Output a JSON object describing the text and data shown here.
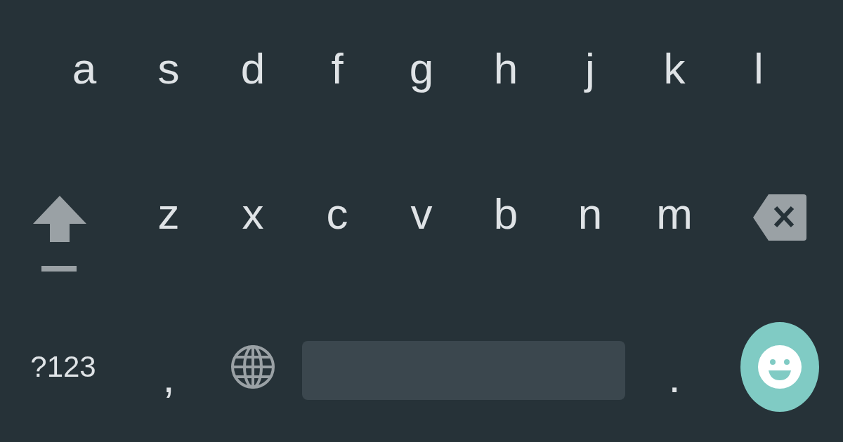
{
  "keyboard": {
    "rows": [
      {
        "keys": [
          {
            "kind": "letter",
            "label": "a"
          },
          {
            "kind": "letter",
            "label": "s"
          },
          {
            "kind": "letter",
            "label": "d"
          },
          {
            "kind": "letter",
            "label": "f"
          },
          {
            "kind": "letter",
            "label": "g"
          },
          {
            "kind": "letter",
            "label": "h"
          },
          {
            "kind": "letter",
            "label": "j"
          },
          {
            "kind": "letter",
            "label": "k"
          },
          {
            "kind": "letter",
            "label": "l"
          }
        ]
      },
      {
        "keys": [
          {
            "kind": "shift"
          },
          {
            "kind": "letter",
            "label": "z"
          },
          {
            "kind": "letter",
            "label": "x"
          },
          {
            "kind": "letter",
            "label": "c"
          },
          {
            "kind": "letter",
            "label": "v"
          },
          {
            "kind": "letter",
            "label": "b"
          },
          {
            "kind": "letter",
            "label": "n"
          },
          {
            "kind": "letter",
            "label": "m"
          },
          {
            "kind": "backspace"
          }
        ]
      },
      {
        "keys": [
          {
            "kind": "symbols",
            "label": "?123"
          },
          {
            "kind": "punct",
            "label": ","
          },
          {
            "kind": "globe"
          },
          {
            "kind": "space"
          },
          {
            "kind": "punct",
            "label": "."
          },
          {
            "kind": "emoji"
          }
        ]
      }
    ]
  }
}
